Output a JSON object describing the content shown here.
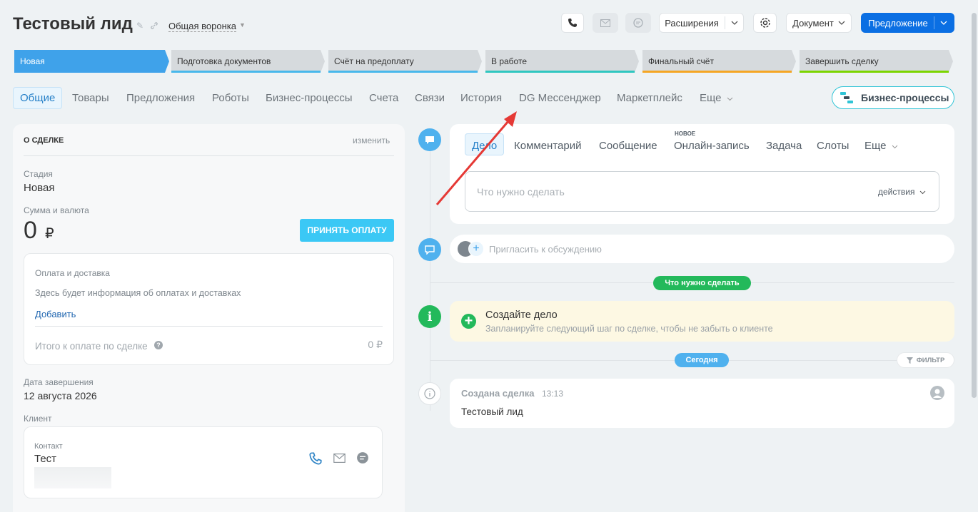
{
  "header": {
    "title": "Тестовый лид",
    "funnel": "Общая воронка",
    "extensions_label": "Расширения",
    "document_label": "Документ",
    "offer_label": "Предложение"
  },
  "stages": [
    {
      "label": "Новая",
      "color": "#3fa2ea"
    },
    {
      "label": "Подготовка документов",
      "color": "#48b8eb"
    },
    {
      "label": "Счёт на предоплату",
      "color": "#48b8eb"
    },
    {
      "label": "В работе",
      "color": "#2fc7c0"
    },
    {
      "label": "Финальный счёт",
      "color": "#f5a623"
    },
    {
      "label": "Завершить сделку",
      "color": "#7bd500"
    }
  ],
  "tabs": [
    "Общие",
    "Товары",
    "Предложения",
    "Роботы",
    "Бизнес-процессы",
    "Счета",
    "Связи",
    "История",
    "DG Мессенджер",
    "Маркетплейс",
    "Еще"
  ],
  "bp_button": "Бизнес-процессы",
  "about": {
    "heading": "О СДЕЛКЕ",
    "edit": "изменить",
    "stage_label": "Стадия",
    "stage_value": "Новая",
    "sum_label": "Сумма и валюта",
    "sum_value": "0",
    "currency": "₽",
    "pay_button": "ПРИНЯТЬ ОПЛАТУ",
    "payment_title": "Оплата и доставка",
    "payment_info": "Здесь будет информация об оплатах и доставках",
    "add_link": "Добавить",
    "total_label": "Итого к оплате по сделке",
    "total_value": "0 ₽",
    "close_date_label": "Дата завершения",
    "close_date_value": "12 августа 2026",
    "client_label": "Клиент",
    "contact_label": "Контакт",
    "contact_name": "Тест"
  },
  "editor": {
    "tabs": [
      "Дело",
      "Комментарий",
      "Сообщение",
      "Онлайн-запись",
      "Задача",
      "Слоты",
      "Еще"
    ],
    "new_badge": "НОВОЕ",
    "placeholder": "Что нужно сделать",
    "actions": "действия"
  },
  "invite_placeholder": "Пригласить к обсуждению",
  "todo_pill": "Что нужно сделать",
  "create_deal": {
    "title": "Создайте дело",
    "subtitle": "Запланируйте следующий шаг по сделке, чтобы не забыть о клиенте"
  },
  "today_pill": "Сегодня",
  "filter_label": "ФИЛЬТР",
  "history_item": {
    "title": "Создана сделка",
    "time": "13:13",
    "text": "Тестовый лид"
  },
  "colors": {
    "accent": "#0b6fe3",
    "arrow": "#e53935",
    "green": "#23b95b",
    "cyan": "#3bc8f5"
  }
}
